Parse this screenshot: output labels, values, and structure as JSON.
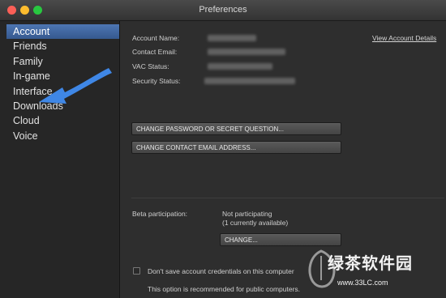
{
  "window": {
    "title": "Preferences"
  },
  "sidebar": {
    "items": [
      {
        "label": "Account",
        "selected": true
      },
      {
        "label": "Friends"
      },
      {
        "label": "Family"
      },
      {
        "label": "In-game"
      },
      {
        "label": "Interface"
      },
      {
        "label": "Downloads"
      },
      {
        "label": "Cloud"
      },
      {
        "label": "Voice"
      }
    ]
  },
  "account": {
    "name_label": "Account Name:",
    "email_label": "Contact Email:",
    "vac_label": "VAC Status:",
    "security_label": "Security Status:",
    "view_details": "View Account Details",
    "change_password": "CHANGE PASSWORD OR SECRET QUESTION...",
    "change_email": "CHANGE CONTACT EMAIL ADDRESS..."
  },
  "beta": {
    "label": "Beta participation:",
    "status": "Not participating",
    "available": "(1 currently available)",
    "change_button": "CHANGE..."
  },
  "credentials": {
    "checkbox_label": "Don't save account credentials on this computer",
    "note": "This option is recommended for public computers."
  },
  "watermark": {
    "text": "绿茶软件园",
    "url": "www.33LC.com"
  },
  "colors": {
    "accent": "#3f87e6",
    "selection": "#4a72ae",
    "background": "#2e2e2e"
  },
  "icons": [
    "close-icon",
    "minimize-icon",
    "zoom-icon",
    "arrow-icon",
    "leaf-logo-icon"
  ]
}
